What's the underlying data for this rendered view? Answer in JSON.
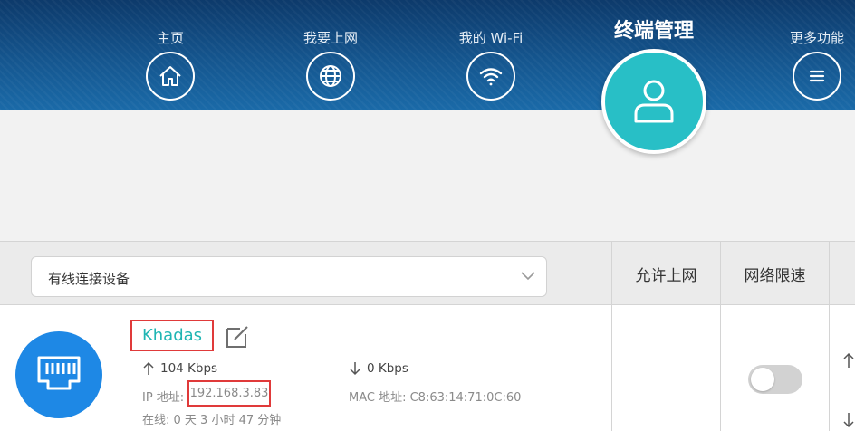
{
  "nav": {
    "items": [
      {
        "label": "主页",
        "icon": "home-icon"
      },
      {
        "label": "我要上网",
        "icon": "globe-icon"
      },
      {
        "label": "我的 Wi-Fi",
        "icon": "wifi-icon"
      },
      {
        "label": "终端管理",
        "icon": "user-icon",
        "active": true
      },
      {
        "label": "更多功能",
        "icon": "menu-icon"
      }
    ]
  },
  "table": {
    "filter_value": "有线连接设备",
    "columns": {
      "allow_internet": "允许上网",
      "speed_limit": "网络限速"
    }
  },
  "device": {
    "name": "Khadas",
    "icon": "ethernet-port-icon",
    "upload": "104 Kbps",
    "download": "0 Kbps",
    "ip_label": "IP 地址:",
    "ip": "192.168.3.83",
    "mac_text": "MAC 地址: C8:63:14:71:0C:60",
    "online_text": "在线: 0 天 3 小时 47 分钟",
    "speed_limit_enabled": false
  },
  "colors": {
    "header_blue": "#15568f",
    "accent_teal": "#28bfc6",
    "device_blue": "#1e88e5",
    "highlight_red": "#e03a3a",
    "name_teal": "#1fb5b3"
  }
}
